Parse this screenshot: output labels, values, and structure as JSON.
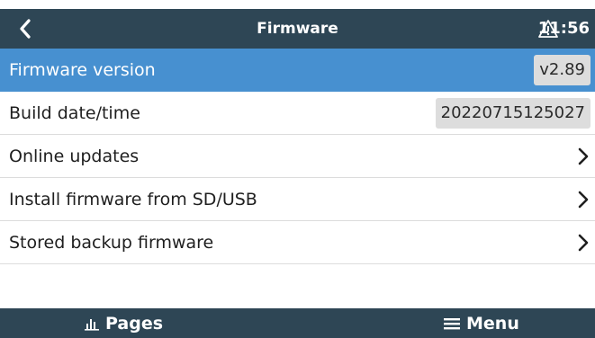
{
  "header": {
    "back_icon": "chevron-left-icon",
    "title": "Firmware",
    "alarm_icon": "warning-triangle-icon",
    "time": "11:56"
  },
  "rows": [
    {
      "label": "Firmware version",
      "value": "v2.89",
      "selected": true
    },
    {
      "label": "Build date/time",
      "value": "20220715125027"
    },
    {
      "label": "Online updates",
      "icon": "chevron-right-icon"
    },
    {
      "label": "Install firmware from SD/USB",
      "icon": "chevron-right-icon"
    },
    {
      "label": "Stored backup firmware",
      "icon": "chevron-right-icon"
    }
  ],
  "footer": {
    "pages_label": "Pages",
    "pages_icon": "bar-chart-icon",
    "menu_label": "Menu",
    "menu_icon": "hamburger-icon"
  },
  "colors": {
    "header_bg": "#2e4655",
    "selected_bg": "#4790d0",
    "value_bg": "#dddddd"
  }
}
